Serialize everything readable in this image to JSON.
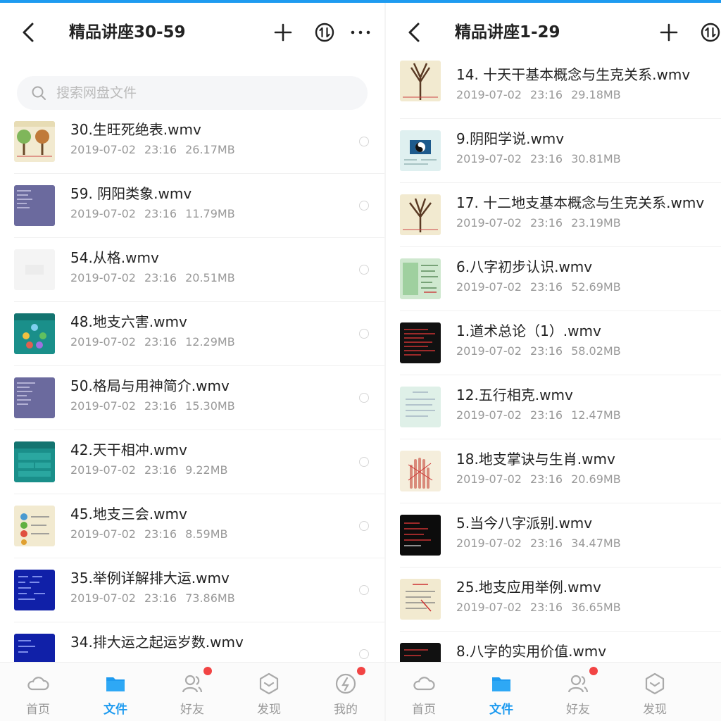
{
  "left": {
    "title": "精品讲座30-59",
    "search_placeholder": "搜索网盘文件",
    "files": [
      {
        "name": "30.生旺死绝表.wmv",
        "date": "2019-07-02",
        "time": "23:16",
        "size": "26.17MB"
      },
      {
        "name": "59. 阴阳类象.wmv",
        "date": "2019-07-02",
        "time": "23:16",
        "size": "11.79MB"
      },
      {
        "name": "54.从格.wmv",
        "date": "2019-07-02",
        "time": "23:16",
        "size": "20.51MB"
      },
      {
        "name": "48.地支六害.wmv",
        "date": "2019-07-02",
        "time": "23:16",
        "size": "12.29MB"
      },
      {
        "name": "50.格局与用神简介.wmv",
        "date": "2019-07-02",
        "time": "23:16",
        "size": "15.30MB"
      },
      {
        "name": "42.天干相冲.wmv",
        "date": "2019-07-02",
        "time": "23:16",
        "size": "9.22MB"
      },
      {
        "name": "45.地支三会.wmv",
        "date": "2019-07-02",
        "time": "23:16",
        "size": "8.59MB"
      },
      {
        "name": "35.举例详解排大运.wmv",
        "date": "2019-07-02",
        "time": "23:16",
        "size": "73.86MB"
      },
      {
        "name": "34.排大运之起运岁数.wmv",
        "date": "",
        "time": "",
        "size": ""
      }
    ],
    "tabs": [
      {
        "label": "首页",
        "icon": "home-cloud-icon",
        "active": false,
        "badge": false
      },
      {
        "label": "文件",
        "icon": "folder-icon",
        "active": true,
        "badge": false
      },
      {
        "label": "好友",
        "icon": "friends-icon",
        "active": false,
        "badge": true
      },
      {
        "label": "发现",
        "icon": "discover-icon",
        "active": false,
        "badge": false
      },
      {
        "label": "我的",
        "icon": "profile-icon",
        "active": false,
        "badge": true
      }
    ]
  },
  "right": {
    "title": "精品讲座1-29",
    "files": [
      {
        "name": "14. 十天干基本概念与生克关系.wmv",
        "date": "2019-07-02",
        "time": "23:16",
        "size": "29.18MB"
      },
      {
        "name": "9.阴阳学说.wmv",
        "date": "2019-07-02",
        "time": "23:16",
        "size": "30.81MB"
      },
      {
        "name": "17. 十二地支基本概念与生克关系.wmv",
        "date": "2019-07-02",
        "time": "23:16",
        "size": "23.19MB"
      },
      {
        "name": "6.八字初步认识.wmv",
        "date": "2019-07-02",
        "time": "23:16",
        "size": "52.69MB"
      },
      {
        "name": "1.道术总论（1）.wmv",
        "date": "2019-07-02",
        "time": "23:16",
        "size": "58.02MB"
      },
      {
        "name": "12.五行相克.wmv",
        "date": "2019-07-02",
        "time": "23:16",
        "size": "12.47MB"
      },
      {
        "name": "18.地支掌诀与生肖.wmv",
        "date": "2019-07-02",
        "time": "23:16",
        "size": "20.69MB"
      },
      {
        "name": "5.当今八字派别.wmv",
        "date": "2019-07-02",
        "time": "23:16",
        "size": "34.47MB"
      },
      {
        "name": "25.地支应用举例.wmv",
        "date": "2019-07-02",
        "time": "23:16",
        "size": "36.65MB"
      },
      {
        "name": "8.八字的实用价值.wmv",
        "date": "",
        "time": "",
        "size": ""
      }
    ],
    "tabs": [
      {
        "label": "首页",
        "icon": "home-cloud-icon",
        "active": false,
        "badge": false
      },
      {
        "label": "文件",
        "icon": "folder-icon",
        "active": true,
        "badge": false
      },
      {
        "label": "好友",
        "icon": "friends-icon",
        "active": false,
        "badge": true
      },
      {
        "label": "发现",
        "icon": "discover-icon",
        "active": false,
        "badge": false
      }
    ]
  },
  "colors": {
    "accent": "#1e9bf0",
    "badge": "#f24444",
    "muted": "#999999"
  }
}
